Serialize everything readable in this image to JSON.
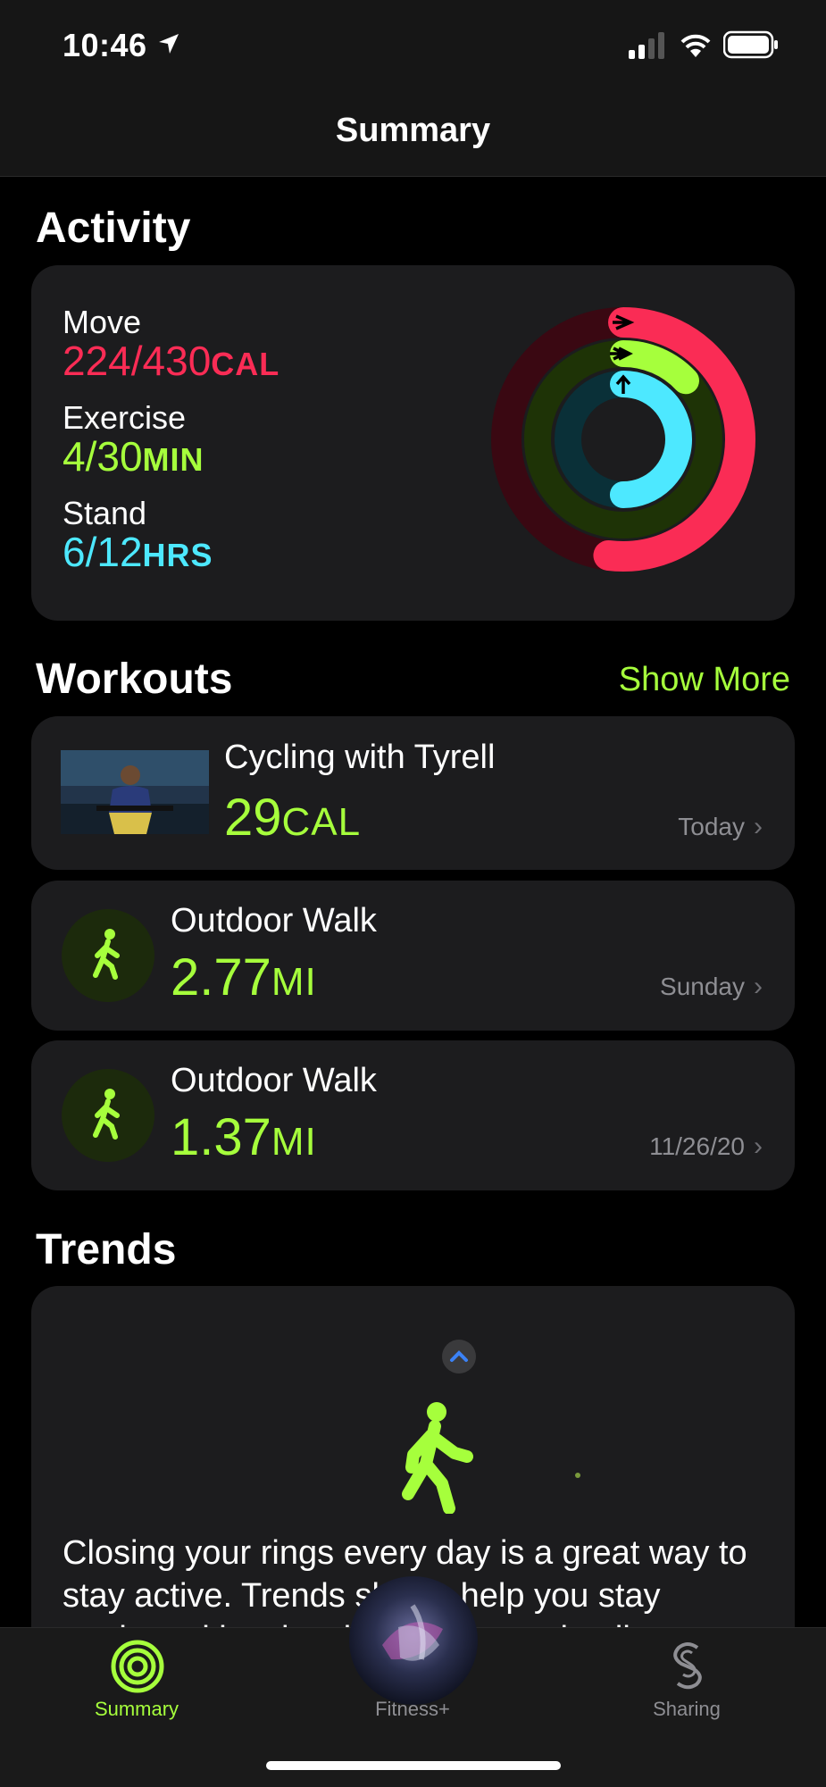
{
  "status_bar": {
    "time": "10:46"
  },
  "nav": {
    "title": "Summary"
  },
  "activity": {
    "section_title": "Activity",
    "move": {
      "label": "Move",
      "value": "224/430",
      "unit": "CAL",
      "progress": 0.52
    },
    "exercise": {
      "label": "Exercise",
      "value": "4/30",
      "unit": "MIN",
      "progress": 0.13
    },
    "stand": {
      "label": "Stand",
      "value": "6/12",
      "unit": "HRS",
      "progress": 0.5
    },
    "colors": {
      "move": "#fa2c55",
      "exercise": "#a6ff3c",
      "stand": "#4de8ff"
    }
  },
  "workouts": {
    "section_title": "Workouts",
    "show_more": "Show More",
    "items": [
      {
        "title": "Cycling with Tyrell",
        "value": "29",
        "unit": "CAL",
        "date": "Today",
        "icon": "video-thumbnail"
      },
      {
        "title": "Outdoor Walk",
        "value": "2.77",
        "unit": "MI",
        "date": "Sunday",
        "icon": "walk-icon"
      },
      {
        "title": "Outdoor Walk",
        "value": "1.37",
        "unit": "MI",
        "date": "11/26/20",
        "icon": "walk-icon"
      }
    ]
  },
  "trends": {
    "section_title": "Trends",
    "body": "Closing your rings every day is a great way to stay active. Trends shows help you stay motivated by showing you more details"
  },
  "tabbar": {
    "tabs": [
      {
        "label": "Summary",
        "icon": "activity-rings-icon",
        "active": true
      },
      {
        "label": "Fitness+",
        "icon": "fitness-plus-icon",
        "active": false
      },
      {
        "label": "Sharing",
        "icon": "sharing-icon",
        "active": false
      }
    ]
  }
}
